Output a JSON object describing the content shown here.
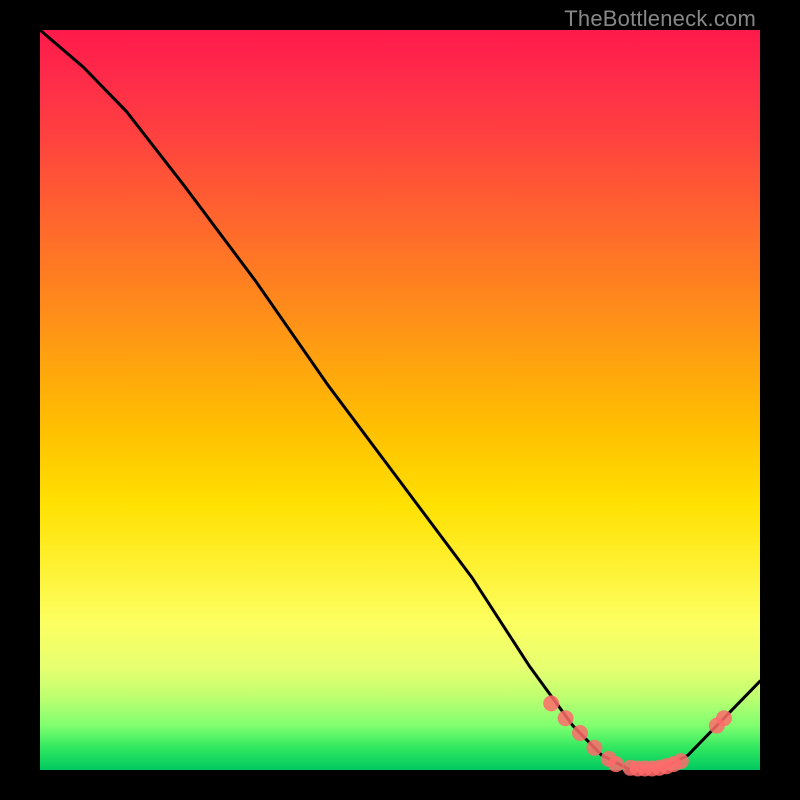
{
  "watermark": "TheBottleneck.com",
  "chart_data": {
    "type": "line",
    "title": "",
    "xlabel": "",
    "ylabel": "",
    "xlim": [
      0,
      100
    ],
    "ylim": [
      0,
      100
    ],
    "grid": false,
    "legend": false,
    "series": [
      {
        "name": "bottleneck-curve",
        "x": [
          0,
          6,
          12,
          20,
          30,
          40,
          50,
          60,
          68,
          74,
          78,
          82,
          86,
          90,
          94,
          100
        ],
        "y": [
          100,
          95,
          89,
          79,
          66,
          52,
          39,
          26,
          14,
          6,
          2,
          0,
          0,
          2,
          6,
          12
        ],
        "color": "#000000"
      }
    ],
    "markers": {
      "name": "highlight-dots",
      "color": "#ff6b6b",
      "radius": 8,
      "points": [
        {
          "x": 71,
          "y": 9
        },
        {
          "x": 73,
          "y": 7
        },
        {
          "x": 75,
          "y": 5
        },
        {
          "x": 77,
          "y": 3
        },
        {
          "x": 79,
          "y": 1.5
        },
        {
          "x": 80,
          "y": 0.8
        },
        {
          "x": 82,
          "y": 0.3
        },
        {
          "x": 83,
          "y": 0.2
        },
        {
          "x": 84,
          "y": 0.2
        },
        {
          "x": 85,
          "y": 0.2
        },
        {
          "x": 86,
          "y": 0.3
        },
        {
          "x": 87,
          "y": 0.5
        },
        {
          "x": 88,
          "y": 0.8
        },
        {
          "x": 89,
          "y": 1.2
        },
        {
          "x": 94,
          "y": 6
        },
        {
          "x": 95,
          "y": 7
        }
      ]
    }
  }
}
